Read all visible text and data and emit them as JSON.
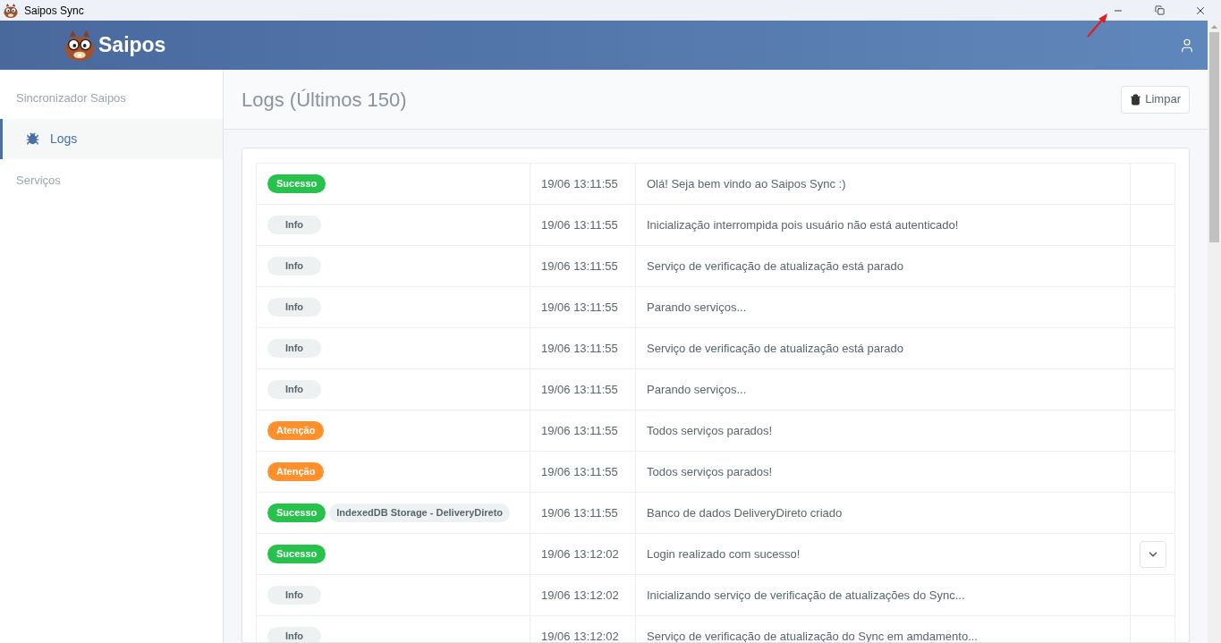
{
  "window": {
    "title": "Saipos Sync"
  },
  "header": {
    "brand": "Saipos"
  },
  "sidebar": {
    "section": "Sincronizador Saipos",
    "items": [
      {
        "label": "Logs",
        "selected": true
      }
    ],
    "section_2": "Serviços"
  },
  "page": {
    "title": "Logs (Últimos 150)",
    "clear_button": "Limpar"
  },
  "logs": [
    {
      "kind": "success",
      "badge": "Sucesso",
      "time": "19/06 13:11:55",
      "message": "Olá! Seja bem vindo ao Saipos Sync :)",
      "expandable": false
    },
    {
      "kind": "info",
      "badge": "Info",
      "time": "19/06 13:11:55",
      "message": "Inicialização interrompida pois usuário não está autenticado!",
      "expandable": false
    },
    {
      "kind": "info",
      "badge": "Info",
      "time": "19/06 13:11:55",
      "message": "Serviço de verificação de atualização está parado",
      "expandable": false
    },
    {
      "kind": "info",
      "badge": "Info",
      "time": "19/06 13:11:55",
      "message": "Parando serviços...",
      "expandable": false
    },
    {
      "kind": "info",
      "badge": "Info",
      "time": "19/06 13:11:55",
      "message": "Serviço de verificação de atualização está parado",
      "expandable": false
    },
    {
      "kind": "info",
      "badge": "Info",
      "time": "19/06 13:11:55",
      "message": "Parando serviços...",
      "expandable": false
    },
    {
      "kind": "warning",
      "badge": "Atenção",
      "time": "19/06 13:11:55",
      "message": "Todos serviços parados!",
      "expandable": false
    },
    {
      "kind": "warning",
      "badge": "Atenção",
      "time": "19/06 13:11:55",
      "message": "Todos serviços parados!",
      "expandable": false
    },
    {
      "kind": "success",
      "badge": "Sucesso",
      "tag": "IndexedDB Storage - DeliveryDireto",
      "time": "19/06 13:11:55",
      "message": "Banco de dados DeliveryDireto criado",
      "expandable": false
    },
    {
      "kind": "success",
      "badge": "Sucesso",
      "time": "19/06 13:12:02",
      "message": "Login realizado com sucesso!",
      "expandable": true
    },
    {
      "kind": "info",
      "badge": "Info",
      "time": "19/06 13:12:02",
      "message": "Inicializando serviço de verificação de atualizações do Sync...",
      "expandable": false
    },
    {
      "kind": "info",
      "badge": "Info",
      "time": "19/06 13:12:02",
      "message": "Serviço de verificação de atualização do Sync em amdamento...",
      "expandable": false
    }
  ]
}
